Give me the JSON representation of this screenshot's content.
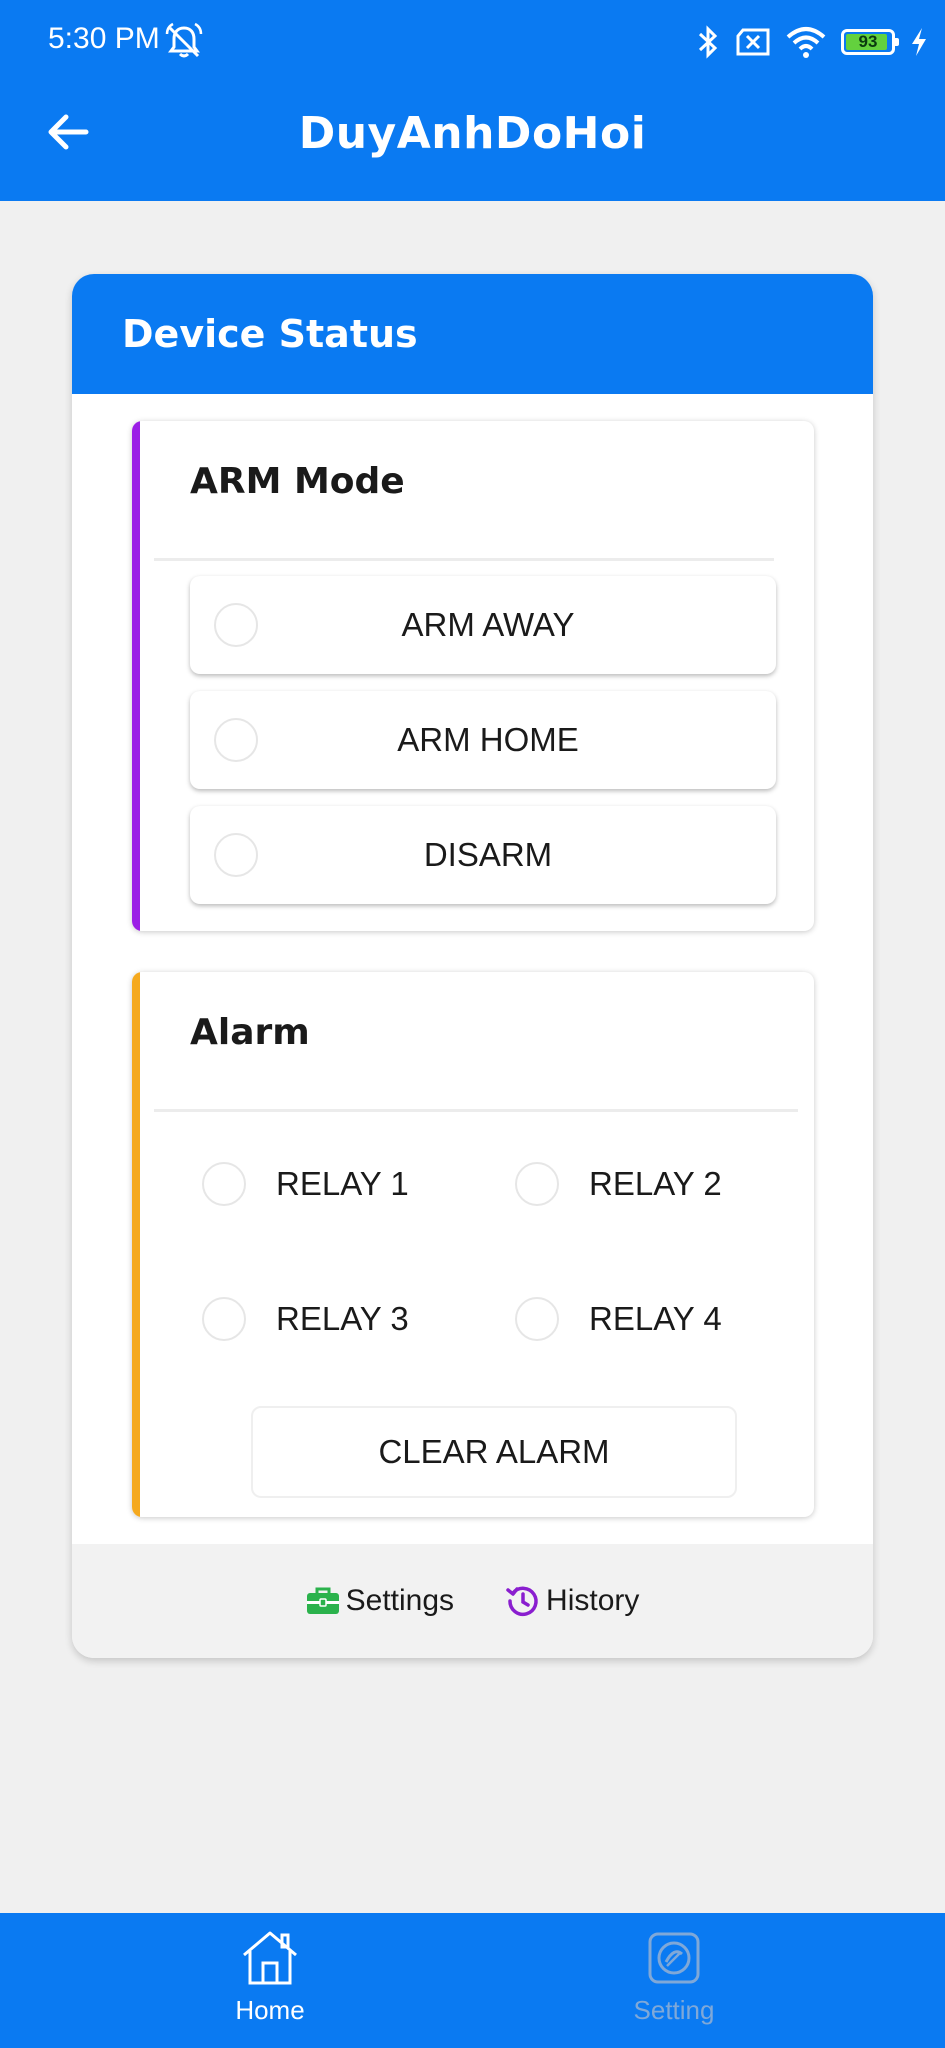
{
  "status_bar": {
    "time": "5:30 PM",
    "battery_level": "93",
    "icons": [
      "dnd-off-icon",
      "bluetooth-icon",
      "sim-error-icon",
      "wifi-icon",
      "battery-icon",
      "charging-icon"
    ]
  },
  "app_bar": {
    "title": "DuyAnhDoHoi",
    "back_icon": "arrow-left-icon"
  },
  "card": {
    "header": "Device Status",
    "arm_panel": {
      "title": "ARM Mode",
      "accent_color": "#9b1ee6",
      "options": [
        "ARM AWAY",
        "ARM HOME",
        "DISARM"
      ]
    },
    "alarm_panel": {
      "title": "Alarm",
      "accent_color": "#f5a91e",
      "relays": [
        "RELAY 1",
        "RELAY 2",
        "RELAY 3",
        "RELAY 4"
      ],
      "clear_button": "CLEAR ALARM"
    },
    "footer": {
      "settings_label": "Settings",
      "settings_color": "#2bb24c",
      "history_label": "History",
      "history_color": "#8a1ecf"
    }
  },
  "bottom_nav": {
    "items": [
      {
        "label": "Home",
        "icon": "home-icon",
        "active": true
      },
      {
        "label": "Setting",
        "icon": "setting-icon",
        "active": false
      }
    ]
  },
  "colors": {
    "primary": "#0a7af2",
    "background": "#f0f0f0"
  }
}
